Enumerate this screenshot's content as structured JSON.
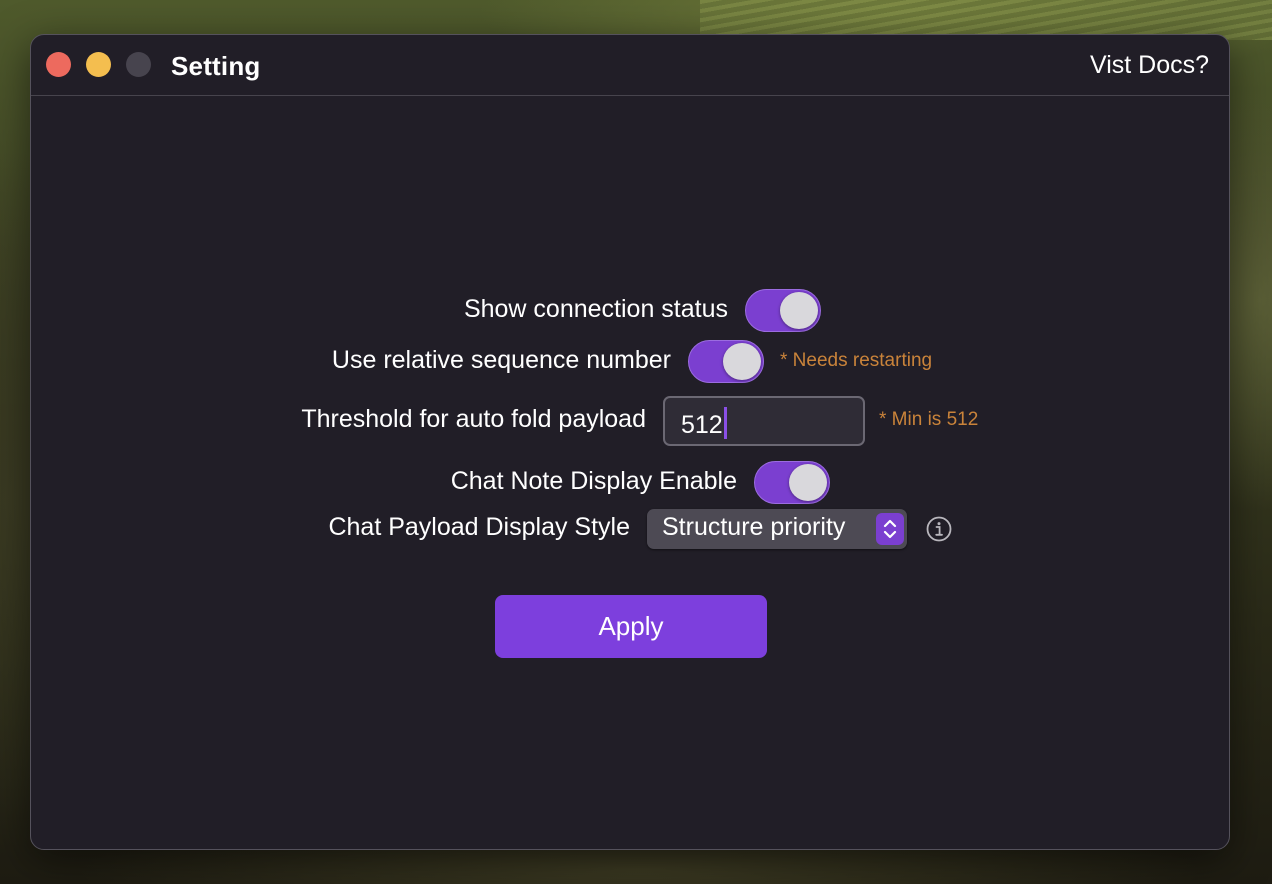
{
  "window": {
    "title": "Setting",
    "docs_link": "Vist Docs?"
  },
  "settings": {
    "show_connection_status": {
      "label": "Show connection status",
      "enabled": true
    },
    "relative_sequence": {
      "label": "Use relative sequence number",
      "enabled": true,
      "note": "* Needs restarting"
    },
    "fold_threshold": {
      "label": "Threshold for auto fold payload",
      "value": "512",
      "note": "* Min is 512"
    },
    "chat_note_display": {
      "label": "Chat Note Display Enable",
      "enabled": true
    },
    "chat_payload_style": {
      "label": "Chat Payload Display Style",
      "selected": "Structure priority"
    }
  },
  "apply_button": "Apply",
  "colors": {
    "accent": "#7b3fd0",
    "note": "#c9833a",
    "window_bg": "#211e27"
  }
}
